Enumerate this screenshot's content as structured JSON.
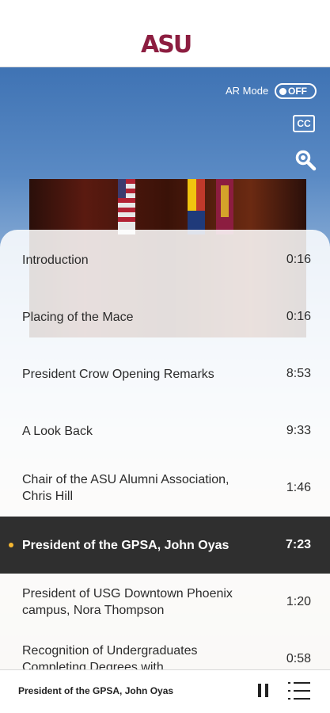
{
  "header": {
    "logo": "ASU"
  },
  "controls": {
    "ar_label": "AR Mode",
    "ar_toggle": "OFF",
    "cc_label": "CC"
  },
  "chapters": [
    {
      "title": "Introduction",
      "time": "0:16"
    },
    {
      "title": "Placing of the Mace",
      "time": "0:16"
    },
    {
      "title": "President Crow Opening Remarks",
      "time": "8:53"
    },
    {
      "title": "A Look Back",
      "time": "9:33"
    },
    {
      "title": "Chair of the ASU Alumni Association, Chris Hill",
      "time": "1:46"
    },
    {
      "title": "President of the GPSA, John Oyas",
      "time": "7:23",
      "active": true
    },
    {
      "title": "President of USG Downtown Phoenix campus, Nora Thompson",
      "time": "1:20"
    },
    {
      "title": "Recognition of Undergraduates Completing Degrees with",
      "time": "0:58"
    }
  ],
  "player": {
    "now_playing": "President of the GPSA, John Oyas"
  },
  "colors": {
    "brand": "#8c1d40",
    "active_row": "#2f2f2f",
    "bullet": "#f5b731",
    "sky": "#3f73b4"
  }
}
